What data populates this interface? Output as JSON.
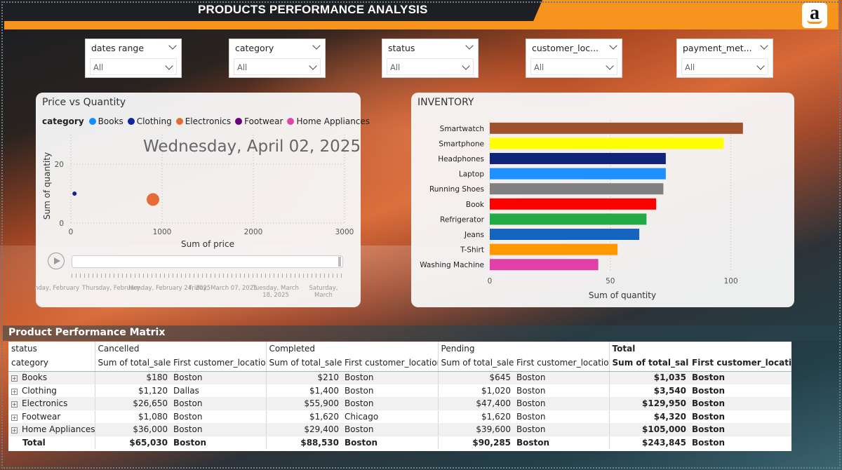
{
  "header": {
    "title": "PRODUCTS PERFORMANCE ANALYSIS",
    "logo_letter": "a"
  },
  "slicers": [
    {
      "title": "dates range",
      "value": "All"
    },
    {
      "title": "category",
      "value": "All"
    },
    {
      "title": "status",
      "value": "All"
    },
    {
      "title": "customer_loc...",
      "value": "All"
    },
    {
      "title": "payment_met...",
      "value": "All"
    }
  ],
  "scatter": {
    "title": "Price vs Quantity",
    "legend_title": "category",
    "date_display": "Wednesday, April 02, 2025",
    "play_labels": [
      "nday, February",
      "Thursday, February",
      "Monday, February 24, 2025",
      "Friday, March 07, 2025",
      "Tuesday, March 18, 2025",
      "Saturday, March"
    ]
  },
  "inventory": {
    "title": "INVENTORY"
  },
  "chart_data": [
    {
      "type": "scatter",
      "title": "Price vs Quantity",
      "xlabel": "Sum of price",
      "ylabel": "Sum of quantity",
      "xlim": [
        0,
        3000
      ],
      "ylim": [
        0,
        30
      ],
      "xticks": [
        0,
        1000,
        2000,
        3000
      ],
      "yticks": [
        0,
        20
      ],
      "legend_title": "category",
      "grid": true,
      "series": [
        {
          "name": "Books",
          "color": "#118dff",
          "points": []
        },
        {
          "name": "Clothing",
          "color": "#12239e",
          "points": [
            {
              "x": 40,
              "y": 10,
              "size": 3
            }
          ]
        },
        {
          "name": "Electronics",
          "color": "#e66c37",
          "points": [
            {
              "x": 900,
              "y": 8,
              "size": 9
            }
          ]
        },
        {
          "name": "Footwear",
          "color": "#6b007b",
          "points": []
        },
        {
          "name": "Home Appliances",
          "color": "#e044a7",
          "points": []
        }
      ]
    },
    {
      "type": "bar",
      "orientation": "horizontal",
      "title": "INVENTORY",
      "xlabel": "Sum of quantity",
      "xlim": [
        0,
        110
      ],
      "xticks": [
        0,
        50,
        100
      ],
      "grid": true,
      "categories": [
        "Smartwatch",
        "Smartphone",
        "Headphones",
        "Laptop",
        "Running Shoes",
        "Book",
        "Refrigerator",
        "Jeans",
        "T-Shirt",
        "Washing Machine"
      ],
      "values": [
        105,
        97,
        73,
        73,
        72,
        69,
        65,
        62,
        53,
        45
      ],
      "colors": [
        "#a0522d",
        "#ffff00",
        "#12237a",
        "#1e90ff",
        "#808080",
        "#ff0000",
        "#22aa44",
        "#1565c0",
        "#ff9800",
        "#e040a8"
      ]
    }
  ],
  "matrix": {
    "title": "Product Performance Matrix",
    "status_label": "status",
    "category_label": "category",
    "groups": [
      "Cancelled",
      "Completed",
      "Pending",
      "Total"
    ],
    "col_sales": "Sum of total_sales",
    "col_location": "First customer_location",
    "rows": [
      {
        "category": "Books",
        "cells": [
          [
            "$180",
            "Boston"
          ],
          [
            "$210",
            "Boston"
          ],
          [
            "$645",
            "Boston"
          ],
          [
            "$1,035",
            "Boston"
          ]
        ]
      },
      {
        "category": "Clothing",
        "cells": [
          [
            "$1,120",
            "Dallas"
          ],
          [
            "$1,400",
            "Boston"
          ],
          [
            "$1,020",
            "Boston"
          ],
          [
            "$3,540",
            "Boston"
          ]
        ]
      },
      {
        "category": "Electronics",
        "cells": [
          [
            "$26,650",
            "Boston"
          ],
          [
            "$55,900",
            "Boston"
          ],
          [
            "$47,400",
            "Boston"
          ],
          [
            "$129,950",
            "Boston"
          ]
        ]
      },
      {
        "category": "Footwear",
        "cells": [
          [
            "$1,080",
            "Boston"
          ],
          [
            "$1,620",
            "Chicago"
          ],
          [
            "$1,620",
            "Boston"
          ],
          [
            "$4,320",
            "Boston"
          ]
        ]
      },
      {
        "category": "Home Appliances",
        "cells": [
          [
            "$36,000",
            "Boston"
          ],
          [
            "$29,400",
            "Boston"
          ],
          [
            "$39,600",
            "Boston"
          ],
          [
            "$105,000",
            "Boston"
          ]
        ]
      }
    ],
    "total": {
      "label": "Total",
      "cells": [
        [
          "$65,030",
          "Boston"
        ],
        [
          "$88,530",
          "Boston"
        ],
        [
          "$90,285",
          "Boston"
        ],
        [
          "$243,845",
          "Boston"
        ]
      ]
    }
  }
}
